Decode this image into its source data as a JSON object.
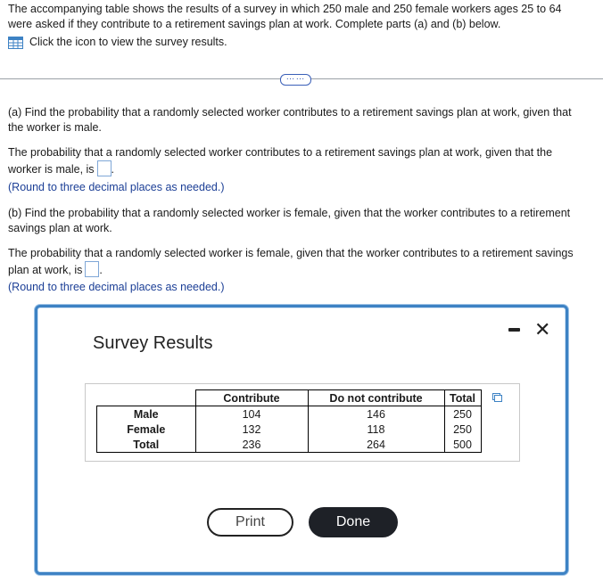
{
  "intro": {
    "line1": "The accompanying table shows the results of a survey in which 250 male and 250 female workers ages 25 to 64",
    "line2": "were asked if they contribute to a retirement savings plan at work. Complete parts (a) and (b) below.",
    "icon_link": "Click the icon to view the survey results."
  },
  "more_button": "……",
  "part_a": {
    "question_l1": "(a) Find the probability that a randomly selected worker contributes to a retirement savings plan at work, given that",
    "question_l2": "the worker is male.",
    "answer_l1": "The probability that a randomly selected worker contributes to a retirement savings plan at work, given that the",
    "answer_l2": "worker is male, is",
    "hint": "(Round to three decimal places as needed.)"
  },
  "part_b": {
    "question_l1": "(b) Find the probability that a randomly selected worker is female, given that the worker contributes to a retirement",
    "question_l2": "savings plan at work.",
    "answer_l1": "The probability that a randomly selected worker is female, given that the worker contributes to a retirement savings",
    "answer_l2": "plan at work, is",
    "hint": "(Round to three decimal places as needed.)"
  },
  "dialog": {
    "title": "Survey Results",
    "close": "✕",
    "table": {
      "headers": [
        "Contribute",
        "Do not contribute",
        "Total"
      ],
      "rows": [
        {
          "label": "Male",
          "values": [
            "104",
            "146",
            "250"
          ]
        },
        {
          "label": "Female",
          "values": [
            "132",
            "118",
            "250"
          ]
        },
        {
          "label": "Total",
          "values": [
            "236",
            "264",
            "500"
          ]
        }
      ]
    },
    "print_label": "Print",
    "done_label": "Done"
  },
  "colors": {
    "accent": "#3d82c4",
    "hint": "#1c3f96",
    "done_bg": "#1e2127"
  }
}
